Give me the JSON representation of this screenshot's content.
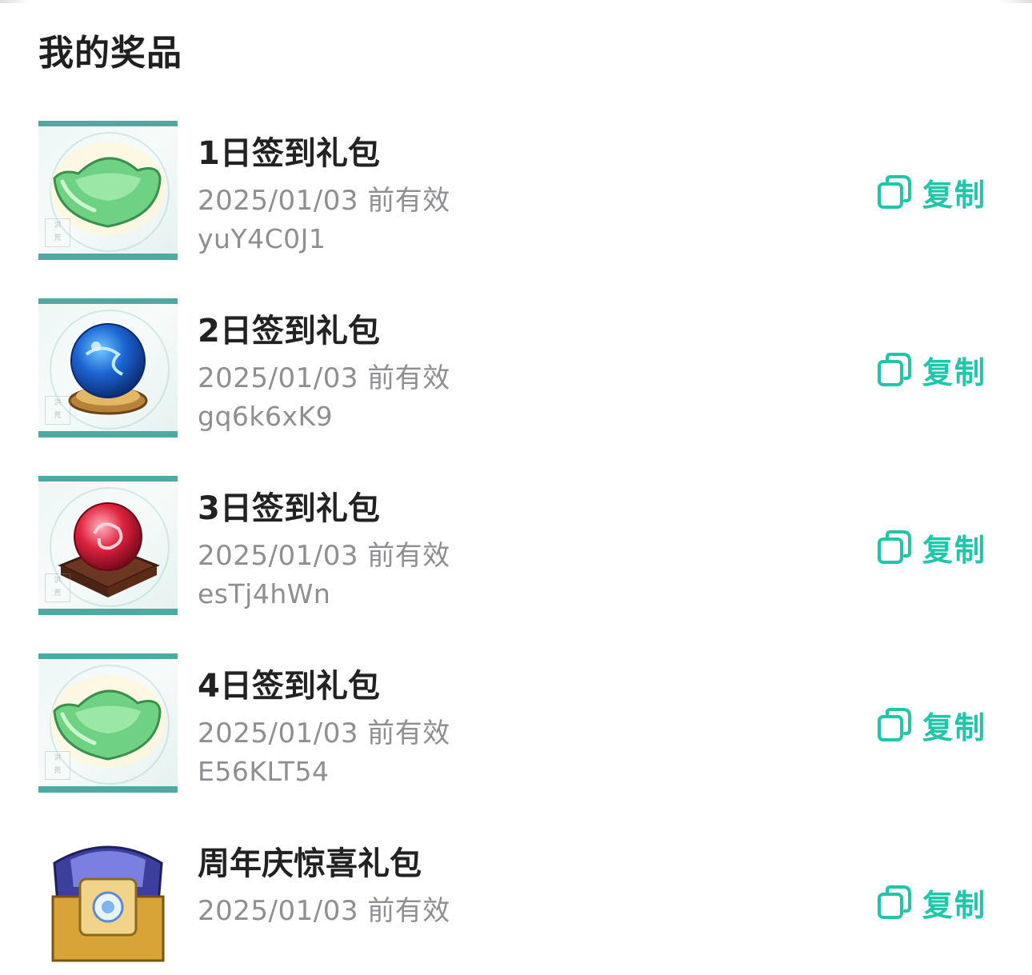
{
  "page": {
    "title": "我的奖品"
  },
  "colors": {
    "accent": "#1dc7a8",
    "title": "#222222",
    "secondary": "#8e8e93"
  },
  "prizes": [
    {
      "name": "1日签到礼包",
      "expiry": "2025/01/03 前有效",
      "code": "yuY4C0J1",
      "copy_label": "复制",
      "icon": "green-ingot-icon"
    },
    {
      "name": "2日签到礼包",
      "expiry": "2025/01/03 前有效",
      "code": "gq6k6xK9",
      "copy_label": "复制",
      "icon": "blue-orb-icon"
    },
    {
      "name": "3日签到礼包",
      "expiry": "2025/01/03 前有效",
      "code": "esTj4hWn",
      "copy_label": "复制",
      "icon": "red-orb-icon"
    },
    {
      "name": "4日签到礼包",
      "expiry": "2025/01/03 前有效",
      "code": "E56KLT54",
      "copy_label": "复制",
      "icon": "green-ingot-icon"
    },
    {
      "name": "周年庆惊喜礼包",
      "expiry": "2025/01/03 前有效",
      "code": "",
      "copy_label": "复制",
      "icon": "treasure-chest-icon"
    }
  ]
}
